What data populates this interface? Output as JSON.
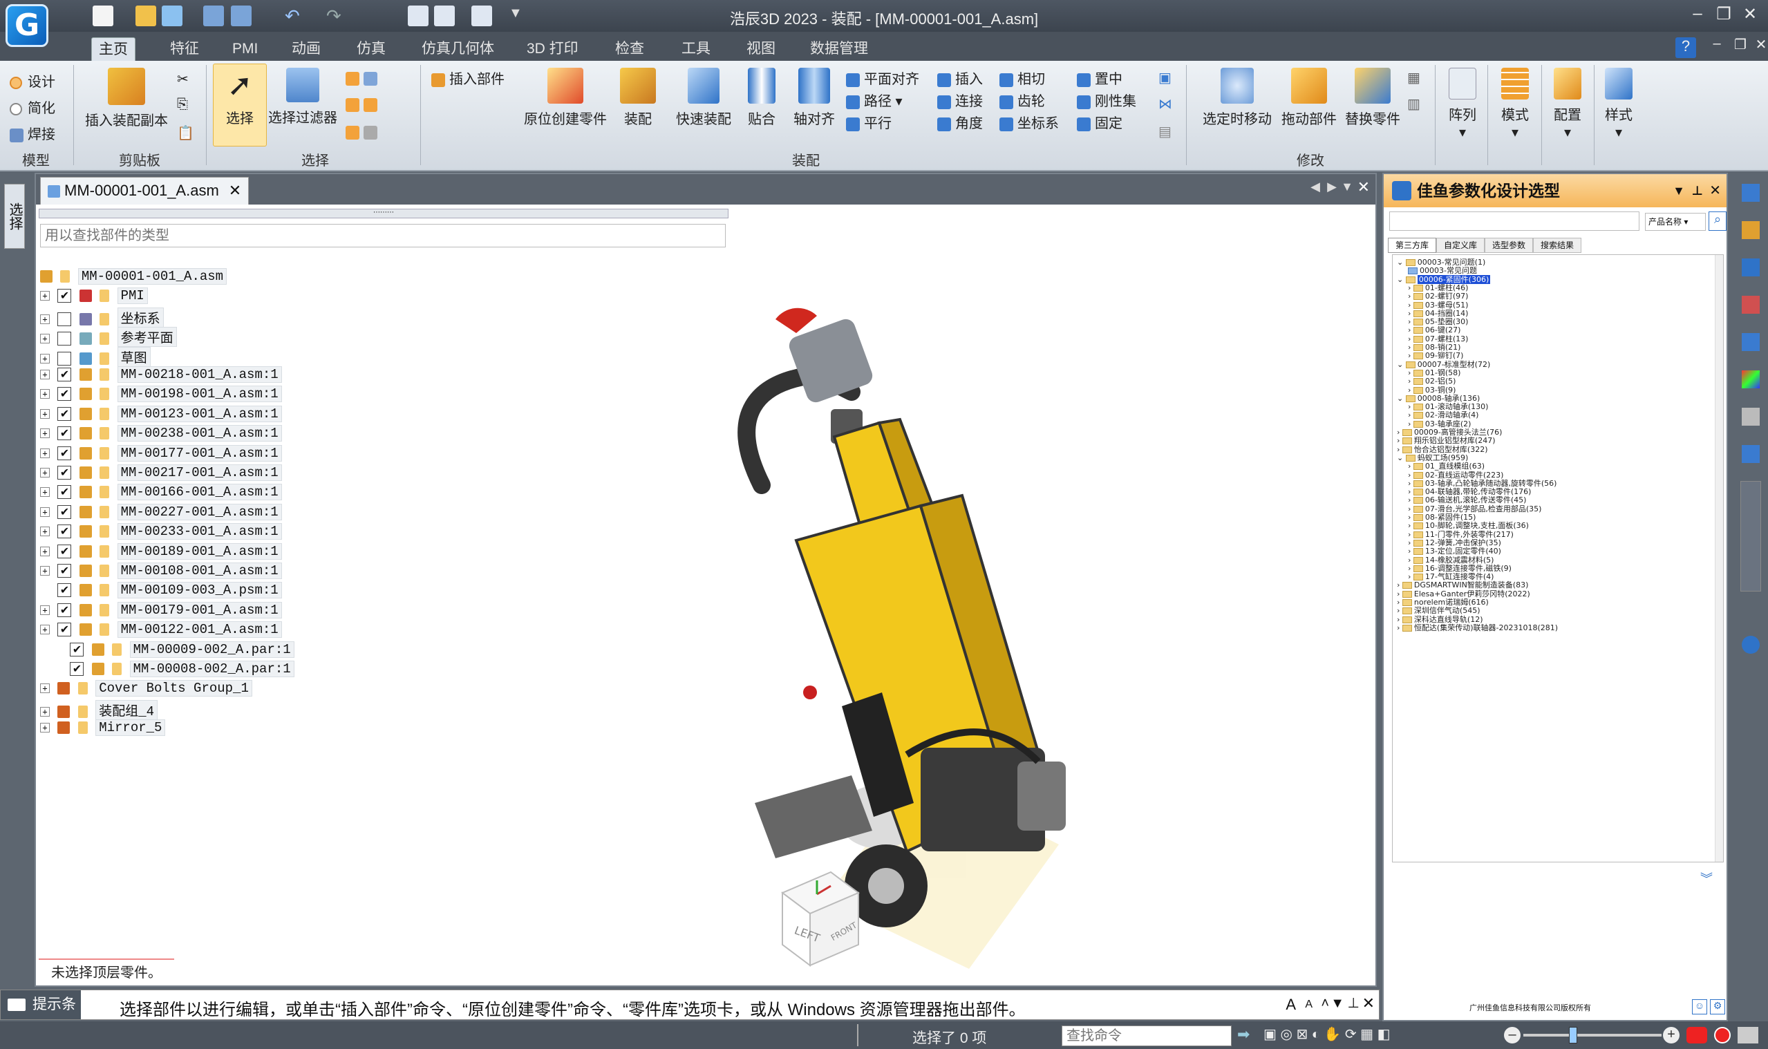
{
  "app": {
    "title": "浩辰3D 2023 - 装配 - [MM-00001-001_A.asm]",
    "logo": "G"
  },
  "tabs": [
    "主页",
    "特征",
    "PMI",
    "动画",
    "仿真",
    "仿真几何体",
    "3D 打印",
    "检查",
    "工具",
    "视图",
    "数据管理"
  ],
  "ribbon": {
    "model": {
      "items": [
        "设计",
        "简化",
        "焊接"
      ],
      "group": "模型"
    },
    "clipboard": {
      "insert_copy": "插入装配副本",
      "group": "剪贴板"
    },
    "select": {
      "select": "选择",
      "filter": "选择过滤器",
      "group": "选择"
    },
    "assembly": {
      "insert_part": "插入部件",
      "create_inplace": "原位创建零件",
      "assemble": "装配",
      "quick": "快速装配",
      "mate": "贴合",
      "axial": "轴对齐",
      "plane_align": "平面对齐",
      "path": "路径",
      "parallel": "平行",
      "insert": "插入",
      "connect": "连接",
      "angle": "角度",
      "tangent": "相切",
      "gear": "齿轮",
      "coordsys": "坐标系",
      "center": "置中",
      "rigid": "刚性集",
      "fixed": "固定",
      "group": "装配"
    },
    "modify": {
      "move_on_select": "选定时移动",
      "drag": "拖动部件",
      "replace": "替换零件",
      "group": "修改"
    },
    "pattern": "阵列",
    "mode": "模式",
    "config": "配置",
    "style": "样式"
  },
  "doc": {
    "tab": "MM-00001-001_A.asm",
    "find_placeholder": "用以查找部件的类型",
    "status": "未选择顶层零件。"
  },
  "tree": [
    {
      "text": "MM-00001-001_A.asm",
      "lvl": 0,
      "exp": false,
      "cb": null,
      "color": "#e0a030"
    },
    {
      "text": "PMI",
      "lvl": 1,
      "exp": true,
      "cb": true,
      "color": "#c33"
    },
    {
      "text": "坐标系",
      "lvl": 1,
      "exp": true,
      "cb": false,
      "color": "#77a"
    },
    {
      "text": "参考平面",
      "lvl": 1,
      "exp": true,
      "cb": false,
      "color": "#7ab"
    },
    {
      "text": "草图",
      "lvl": 1,
      "exp": true,
      "cb": false,
      "color": "#59c"
    },
    {
      "text": "MM-00218-001_A.asm:1",
      "lvl": 1,
      "exp": true,
      "cb": true,
      "color": "#e0a030"
    },
    {
      "text": "MM-00198-001_A.asm:1",
      "lvl": 1,
      "exp": true,
      "cb": true,
      "color": "#e0a030"
    },
    {
      "text": "MM-00123-001_A.asm:1",
      "lvl": 1,
      "exp": true,
      "cb": true,
      "color": "#e0a030"
    },
    {
      "text": "MM-00238-001_A.asm:1",
      "lvl": 1,
      "exp": true,
      "cb": true,
      "color": "#e0a030"
    },
    {
      "text": "MM-00177-001_A.asm:1",
      "lvl": 1,
      "exp": true,
      "cb": true,
      "color": "#e0a030"
    },
    {
      "text": "MM-00217-001_A.asm:1",
      "lvl": 1,
      "exp": true,
      "cb": true,
      "color": "#e0a030"
    },
    {
      "text": "MM-00166-001_A.asm:1",
      "lvl": 1,
      "exp": true,
      "cb": true,
      "color": "#e0a030"
    },
    {
      "text": "MM-00227-001_A.asm:1",
      "lvl": 1,
      "exp": true,
      "cb": true,
      "color": "#e0a030"
    },
    {
      "text": "MM-00233-001_A.asm:1",
      "lvl": 1,
      "exp": true,
      "cb": true,
      "color": "#e0a030"
    },
    {
      "text": "MM-00189-001_A.asm:1",
      "lvl": 1,
      "exp": true,
      "cb": true,
      "color": "#e0a030"
    },
    {
      "text": "MM-00108-001_A.asm:1",
      "lvl": 1,
      "exp": true,
      "cb": true,
      "color": "#e0a030"
    },
    {
      "text": "MM-00109-003_A.psm:1",
      "lvl": 1,
      "exp": false,
      "cb": true,
      "color": "#e0a030"
    },
    {
      "text": "MM-00179-001_A.asm:1",
      "lvl": 1,
      "exp": true,
      "cb": true,
      "color": "#e0a030"
    },
    {
      "text": "MM-00122-001_A.asm:1",
      "lvl": 1,
      "exp": true,
      "cb": true,
      "color": "#e0a030"
    },
    {
      "text": "MM-00009-002_A.par:1",
      "lvl": 2,
      "exp": false,
      "cb": true,
      "color": "#e0a030"
    },
    {
      "text": "MM-00008-002_A.par:1",
      "lvl": 2,
      "exp": false,
      "cb": true,
      "color": "#e0a030"
    },
    {
      "text": "Cover Bolts Group_1",
      "lvl": 1,
      "exp": true,
      "cb": null,
      "color": "#d06020"
    },
    {
      "text": "装配组_4",
      "lvl": 1,
      "exp": true,
      "cb": null,
      "color": "#d06020"
    },
    {
      "text": "Mirror_5",
      "lvl": 1,
      "exp": true,
      "cb": null,
      "color": "#d06020"
    }
  ],
  "viewcube": {
    "left": "LEFT",
    "front": "FRONT"
  },
  "prompt": {
    "label": "提示条",
    "text": "选择部件以进行编辑，或单击“插入部件”命令、“原位创建零件”命令、“零件库”选项卡，或从 Windows 资源管理器拖出部件。"
  },
  "statusbar": {
    "selected": "选择了 0 项",
    "find_cmd": "查找命令"
  },
  "rightpanel": {
    "title": "佳鱼参数化设计选型",
    "combo": "产品名称",
    "tabs": [
      "第三方库",
      "自定义库",
      "选型参数",
      "搜索结果"
    ],
    "tree": [
      {
        "t": "00003-常见问题(1)",
        "l": 0,
        "o": true
      },
      {
        "t": "00003-常见问题",
        "l": 1,
        "o": false,
        "file": true
      },
      {
        "t": "00006-紧固件(306)",
        "l": 0,
        "o": true,
        "sel": true
      },
      {
        "t": "01-螺柱(46)",
        "l": 1
      },
      {
        "t": "02-螺钉(97)",
        "l": 1
      },
      {
        "t": "03-螺母(51)",
        "l": 1
      },
      {
        "t": "04-挡圈(14)",
        "l": 1
      },
      {
        "t": "05-垫圈(30)",
        "l": 1
      },
      {
        "t": "06-键(27)",
        "l": 1
      },
      {
        "t": "07-螺柱(13)",
        "l": 1
      },
      {
        "t": "08-销(21)",
        "l": 1
      },
      {
        "t": "09-铆钉(7)",
        "l": 1
      },
      {
        "t": "00007-标准型材(72)",
        "l": 0,
        "o": true
      },
      {
        "t": "01-钢(58)",
        "l": 1
      },
      {
        "t": "02-铝(5)",
        "l": 1
      },
      {
        "t": "03-铜(9)",
        "l": 1
      },
      {
        "t": "00008-轴承(136)",
        "l": 0,
        "o": true
      },
      {
        "t": "01-滚动轴承(130)",
        "l": 1
      },
      {
        "t": "02-滑动轴承(4)",
        "l": 1
      },
      {
        "t": "03-轴承座(2)",
        "l": 1
      },
      {
        "t": "00009-高管接头法兰(76)",
        "l": 0
      },
      {
        "t": "翔乐铝业铝型材库(247)",
        "l": 0
      },
      {
        "t": "怡合达铝型材库(322)",
        "l": 0
      },
      {
        "t": "蚂蚁工场(959)",
        "l": 0,
        "o": true
      },
      {
        "t": "01_直线模组(63)",
        "l": 1
      },
      {
        "t": "02-直线运动零件(223)",
        "l": 1
      },
      {
        "t": "03-轴承,凸轮轴承随动器,旋转零件(56)",
        "l": 1
      },
      {
        "t": "04-联轴器,带轮,传动零件(176)",
        "l": 1
      },
      {
        "t": "06-输送机,滚轮,传送零件(45)",
        "l": 1
      },
      {
        "t": "07-滑台,光学部品,检查用部品(35)",
        "l": 1
      },
      {
        "t": "08-紧固件(15)",
        "l": 1
      },
      {
        "t": "10-脚轮,调整块,支柱,面板(36)",
        "l": 1
      },
      {
        "t": "11-门零件,外装零件(217)",
        "l": 1
      },
      {
        "t": "12-弹簧,冲击保护(35)",
        "l": 1
      },
      {
        "t": "13-定位,固定零件(40)",
        "l": 1
      },
      {
        "t": "14-橡胶减震材料(5)",
        "l": 1
      },
      {
        "t": "16-调整连接零件,磁铁(9)",
        "l": 1
      },
      {
        "t": "17-气缸连接零件(4)",
        "l": 1
      },
      {
        "t": "DGSMARTWIN智能制造装备(83)",
        "l": 0
      },
      {
        "t": "Elesa+Ganter伊莉莎冈特(2022)",
        "l": 0
      },
      {
        "t": "norelem诺瑞姆(616)",
        "l": 0
      },
      {
        "t": "深圳信伴气动(545)",
        "l": 0
      },
      {
        "t": "深科达直线导轨(12)",
        "l": 0
      },
      {
        "t": "恒配达(集荣传动)联轴器-20231018(281)",
        "l": 0
      }
    ],
    "copyright": "广州佳鱼信息科技有限公司版权所有"
  },
  "colors": {
    "accent": "#f6b65a",
    "ribbon": "#dde4ec",
    "titlebar": "#4e5763"
  }
}
